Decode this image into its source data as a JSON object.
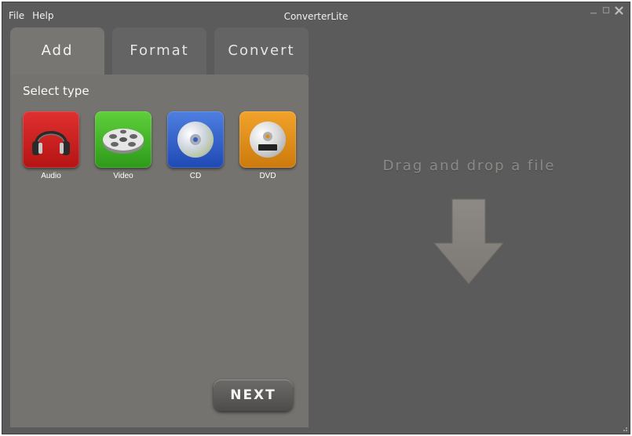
{
  "app": {
    "title": "ConverterLite"
  },
  "menu": [
    {
      "label": "File"
    },
    {
      "label": "Help"
    }
  ],
  "tabs": [
    {
      "label": "Add",
      "active": true
    },
    {
      "label": "Format",
      "active": false
    },
    {
      "label": "Convert",
      "active": false
    }
  ],
  "panel": {
    "title": "Select type",
    "types": [
      {
        "label": "Audio",
        "icon": "headphones-icon",
        "color": "#d42020"
      },
      {
        "label": "Video",
        "icon": "film-reel-icon",
        "color": "#3fb022"
      },
      {
        "label": "CD",
        "icon": "cd-disc-icon",
        "color": "#2f5fcc"
      },
      {
        "label": "DVD",
        "icon": "dvd-disc-icon",
        "color": "#e08c16"
      }
    ],
    "next_label": "NEXT"
  },
  "dropzone": {
    "text": "Drag and drop a file",
    "icon": "arrow-down-icon"
  },
  "window_controls": [
    {
      "icon": "minimize-icon"
    },
    {
      "icon": "maximize-icon"
    },
    {
      "icon": "close-icon"
    }
  ],
  "colors": {
    "window_bg": "#5b5b5b",
    "panel_bg": "#75736f",
    "tab_bg": "#646464",
    "drop_text": "#8c8a87"
  }
}
